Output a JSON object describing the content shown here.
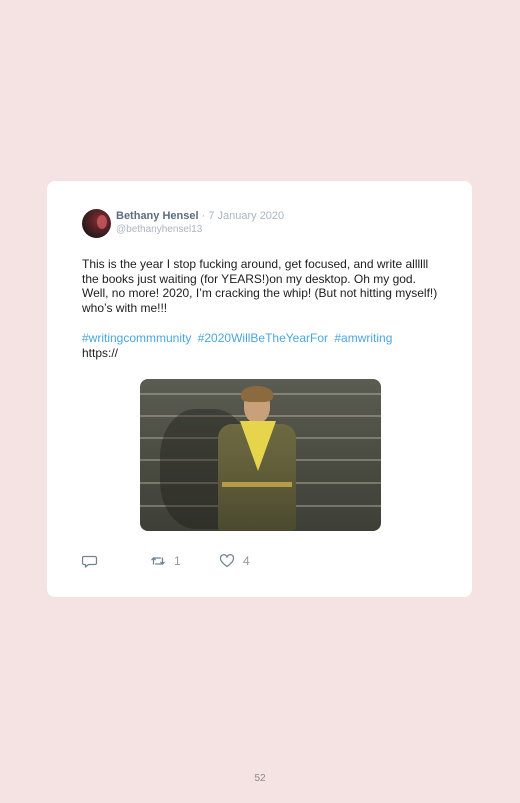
{
  "tweet": {
    "author_name": "Bethany Hensel",
    "separator": "·",
    "date": "7 January 2020",
    "handle": "@bethanyhensel13",
    "body": "This is the year I stop fucking around, get focused, and write allllll the books just waiting (for YEARS!)on my desktop. Oh my god. Well, no more! 2020, I’m cracking the whip! (But not hitting myself!) who’s with me!!!",
    "hashtags": [
      "#writingcommmunity",
      "#2020WillBeTheYearFor",
      "#amwriting"
    ],
    "link": "https://",
    "actions": {
      "reply_icon": "reply-icon",
      "retweet_icon": "retweet-icon",
      "retweet_count": "1",
      "like_icon": "heart-icon",
      "like_count": "4"
    }
  },
  "page": {
    "number": "52"
  },
  "colors": {
    "background": "#f5e3e4",
    "card": "#ffffff",
    "hashtag": "#4aa7de",
    "author_name": "#5b6d80",
    "meta": "#a9b6c2"
  }
}
